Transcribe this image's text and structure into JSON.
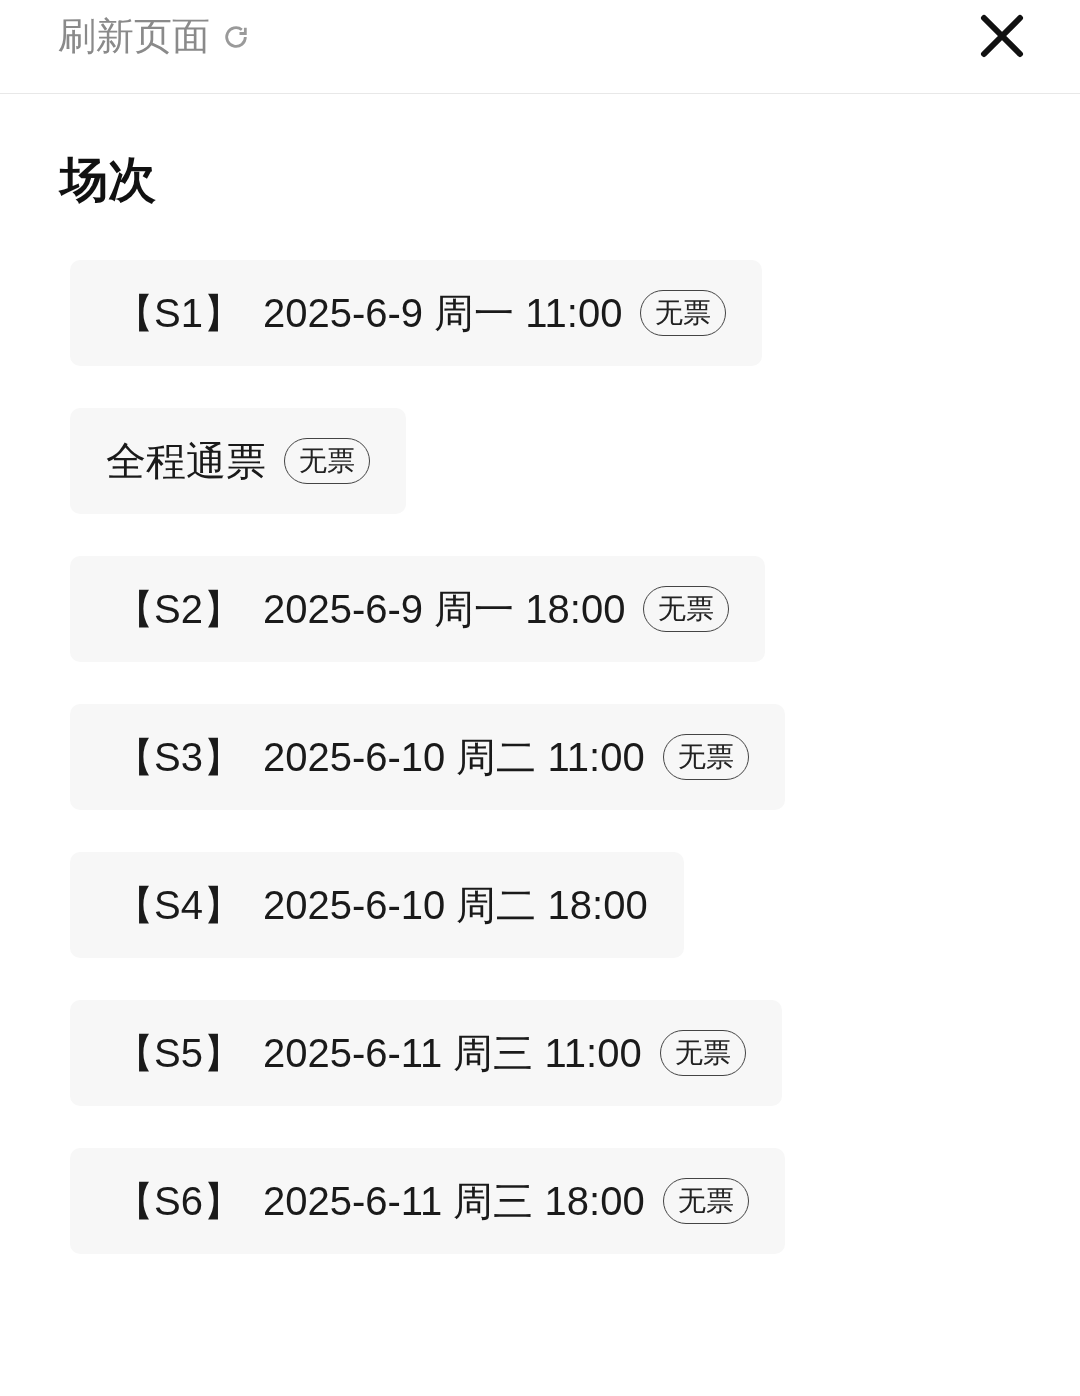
{
  "header": {
    "refresh_label": "刷新页面"
  },
  "section_title": "场次",
  "sessions": [
    {
      "kind": "session",
      "code": "【S1】",
      "time": "2025-6-9 周一 11:00",
      "badge": "无票"
    },
    {
      "kind": "pass",
      "title": "全程通票",
      "badge": "无票"
    },
    {
      "kind": "session",
      "code": "【S2】",
      "time": "2025-6-9 周一 18:00",
      "badge": "无票"
    },
    {
      "kind": "session",
      "code": "【S3】",
      "time": "2025-6-10 周二 11:00",
      "badge": "无票"
    },
    {
      "kind": "session",
      "code": "【S4】",
      "time": "2025-6-10 周二 18:00"
    },
    {
      "kind": "session",
      "code": "【S5】",
      "time": "2025-6-11 周三 11:00",
      "badge": "无票"
    },
    {
      "kind": "session",
      "code": "【S6】",
      "time": "2025-6-11 周三 18:00",
      "badge": "无票"
    }
  ]
}
